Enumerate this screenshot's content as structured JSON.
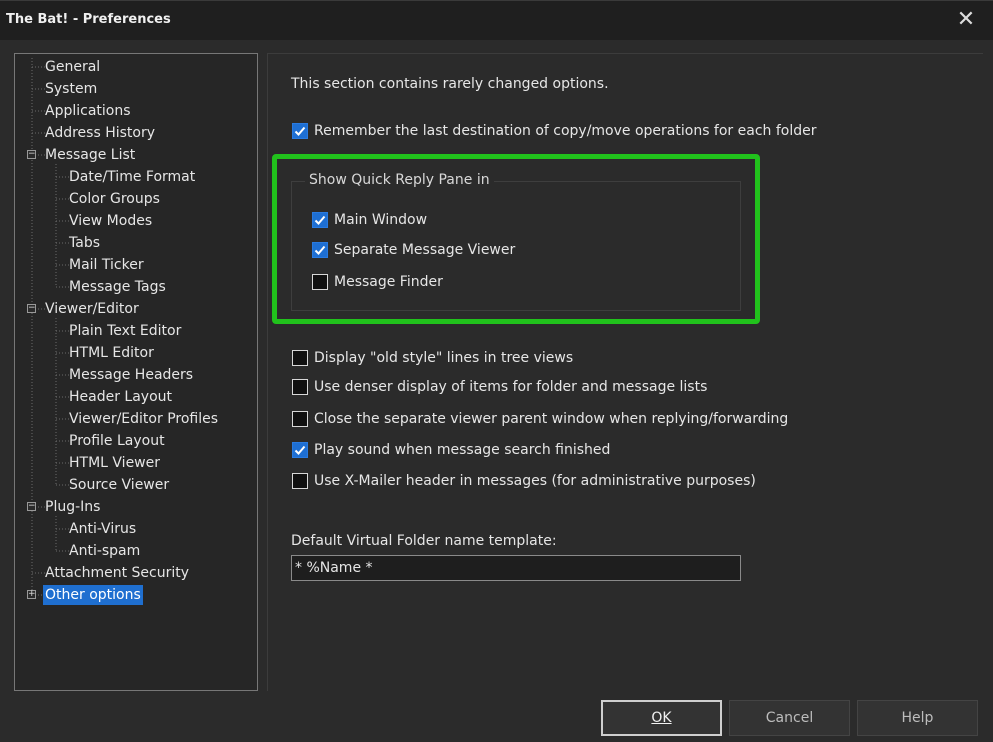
{
  "window": {
    "title": "The Bat! - Preferences",
    "close_glyph": "✕"
  },
  "tree": {
    "items": [
      {
        "label": "General"
      },
      {
        "label": "System"
      },
      {
        "label": "Applications"
      },
      {
        "label": "Address History"
      },
      {
        "label": "Message List",
        "expander": "−"
      },
      {
        "label": "Date/Time Format"
      },
      {
        "label": "Color Groups"
      },
      {
        "label": "View Modes"
      },
      {
        "label": "Tabs"
      },
      {
        "label": "Mail Ticker"
      },
      {
        "label": "Message Tags"
      },
      {
        "label": "Viewer/Editor",
        "expander": "−"
      },
      {
        "label": "Plain Text Editor"
      },
      {
        "label": "HTML Editor"
      },
      {
        "label": "Message Headers"
      },
      {
        "label": "Header Layout"
      },
      {
        "label": "Viewer/Editor Profiles"
      },
      {
        "label": "Profile Layout"
      },
      {
        "label": "HTML Viewer"
      },
      {
        "label": "Source Viewer"
      },
      {
        "label": "Plug-Ins",
        "expander": "−"
      },
      {
        "label": "Anti-Virus"
      },
      {
        "label": "Anti-spam"
      },
      {
        "label": "Attachment Security"
      },
      {
        "label": "Other options",
        "expander": "+",
        "selected": true
      }
    ]
  },
  "content": {
    "intro": "This section contains rarely changed options.",
    "remember_copy_move": {
      "label": "Remember the last destination of copy/move operations for each folder",
      "checked": true
    },
    "quick_reply": {
      "title": "Show Quick Reply Pane in",
      "main_window": {
        "label": "Main Window",
        "checked": true
      },
      "separate_viewer": {
        "label": "Separate Message Viewer",
        "checked": true
      },
      "message_finder": {
        "label": "Message Finder",
        "checked": false
      }
    },
    "old_style_lines": {
      "label": "Display \"old style\" lines in tree views",
      "checked": false
    },
    "denser_display": {
      "label": "Use denser display of items for folder and message lists",
      "checked": false
    },
    "close_parent": {
      "label": "Close the separate viewer parent window when replying/forwarding",
      "checked": false
    },
    "play_sound": {
      "label": "Play sound when message search finished",
      "checked": true
    },
    "x_mailer": {
      "label": "Use X-Mailer header in messages (for administrative purposes)",
      "checked": false
    },
    "virtual_folder": {
      "label": "Default Virtual Folder name template:",
      "value": "* %Name *"
    }
  },
  "buttons": {
    "ok": "OK",
    "cancel": "Cancel",
    "help": "Help"
  },
  "colors": {
    "highlight": "#21c21c",
    "accent": "#1e6fd3"
  }
}
